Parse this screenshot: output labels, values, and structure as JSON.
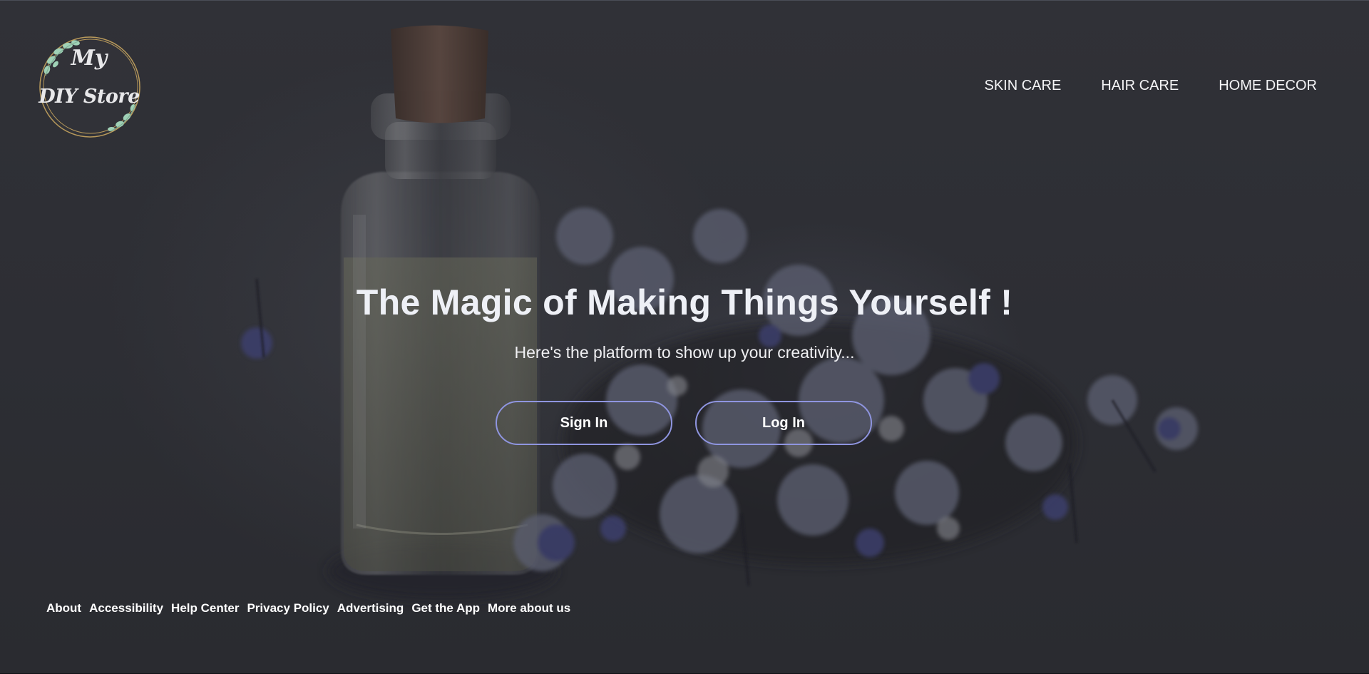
{
  "logo": {
    "line1": "My",
    "line2": "DIY Store",
    "icon": "eucalyptus-wreath-logo"
  },
  "nav": {
    "items": [
      {
        "label": "SKIN CARE"
      },
      {
        "label": "HAIR CARE"
      },
      {
        "label": "HOME DECOR"
      }
    ]
  },
  "hero": {
    "title": "The Magic of Making Things Yourself !",
    "subtitle": "Here's the platform to show up your creativity...",
    "sign_in_label": "Sign In",
    "log_in_label": "Log In"
  },
  "footer": {
    "links": [
      {
        "label": "About"
      },
      {
        "label": "Accessibility"
      },
      {
        "label": "Help Center"
      },
      {
        "label": "Privacy Policy"
      },
      {
        "label": "Advertising"
      },
      {
        "label": "Get the App"
      },
      {
        "label": "More about us"
      }
    ]
  },
  "colors": {
    "background": "#2d2e34",
    "button_border": "#8f95e0",
    "text": "#ffffff"
  }
}
